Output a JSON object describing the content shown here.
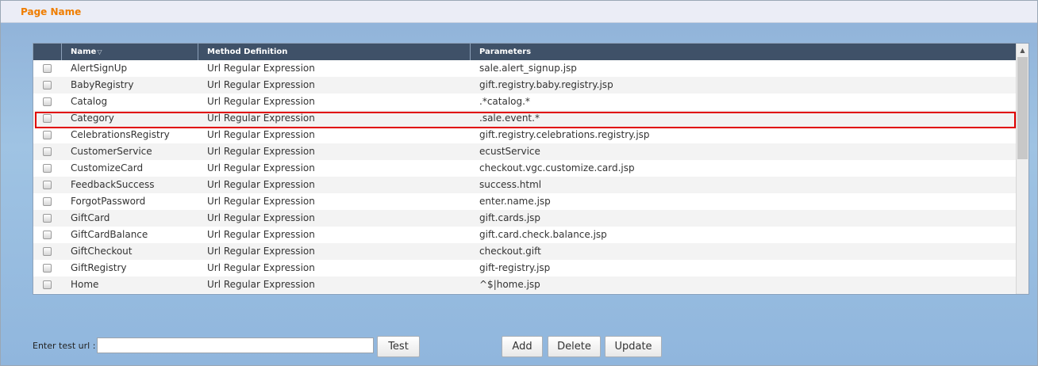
{
  "panel": {
    "title": "Page Name"
  },
  "table": {
    "columns": [
      {
        "label": "Name",
        "sort_glyph": "▽"
      },
      {
        "label": "Method Definition"
      },
      {
        "label": "Parameters"
      }
    ],
    "rows": [
      {
        "name": "AlertSignUp",
        "method": "Url Regular Expression",
        "params": "sale.alert_signup.jsp"
      },
      {
        "name": "BabyRegistry",
        "method": "Url Regular Expression",
        "params": "gift.registry.baby.registry.jsp"
      },
      {
        "name": "Catalog",
        "method": "Url Regular Expression",
        "params": ".*catalog.*"
      },
      {
        "name": "Category",
        "method": "Url Regular Expression",
        "params": ".sale.event.*"
      },
      {
        "name": "CelebrationsRegistry",
        "method": "Url Regular Expression",
        "params": "gift.registry.celebrations.registry.jsp"
      },
      {
        "name": "CustomerService",
        "method": "Url Regular Expression",
        "params": "ecustService"
      },
      {
        "name": "CustomizeCard",
        "method": "Url Regular Expression",
        "params": "checkout.vgc.customize.card.jsp"
      },
      {
        "name": "FeedbackSuccess",
        "method": "Url Regular Expression",
        "params": "success.html"
      },
      {
        "name": "ForgotPassword",
        "method": "Url Regular Expression",
        "params": "enter.name.jsp"
      },
      {
        "name": "GiftCard",
        "method": "Url Regular Expression",
        "params": "gift.cards.jsp"
      },
      {
        "name": "GiftCardBalance",
        "method": "Url Regular Expression",
        "params": "gift.card.check.balance.jsp"
      },
      {
        "name": "GiftCheckout",
        "method": "Url Regular Expression",
        "params": "checkout.gift"
      },
      {
        "name": "GiftRegistry",
        "method": "Url Regular Expression",
        "params": "gift-registry.jsp"
      },
      {
        "name": "Home",
        "method": "Url Regular Expression",
        "params": "^$|home.jsp"
      }
    ],
    "highlighted_row": "Category",
    "scroll_up_glyph": "▲"
  },
  "test_url": {
    "label": "Enter test url :",
    "value": ""
  },
  "buttons": {
    "test": "Test",
    "add": "Add",
    "delete": "Delete",
    "update": "Update"
  },
  "colors": {
    "accent": "#ef7d00",
    "header": "#3f5168",
    "highlight": "#e00000"
  }
}
